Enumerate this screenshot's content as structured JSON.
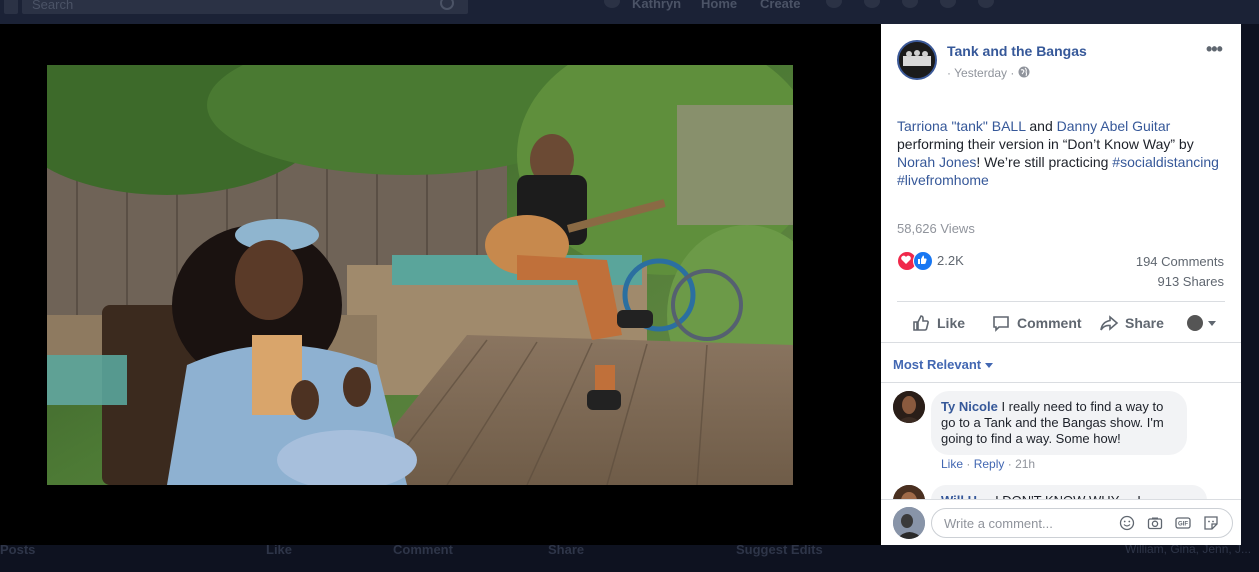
{
  "topbar": {
    "search_placeholder": "Search",
    "user_name": "Kathryn",
    "nav_home": "Home",
    "nav_create": "Create"
  },
  "bottombar": {
    "posts_label": "Posts",
    "like_label": "Like",
    "comment_label": "Comment",
    "share_label": "Share",
    "suggest_edits_label": "Suggest Edits",
    "right_text": "William, Gina, Jenn, J..."
  },
  "post": {
    "page_name": "Tank and the Bangas",
    "time": "· Yesterday ·",
    "text": {
      "mention1": "Tarriona \"tank\" BALL",
      "and": " and ",
      "mention2": "Danny Abel Guitar",
      "middle": " performing their version in “Don’t Know Way” by ",
      "mention3": "Norah Jones",
      "after": "! We’re still practicing ",
      "hashtag1": "#socialdistancing",
      "hashtag2": "#livefromhome"
    },
    "views": "58,626 Views",
    "reactions_count": "2.2K",
    "comments_count": "194 Comments",
    "shares_count": "913 Shares",
    "actions": {
      "like": "Like",
      "comment": "Comment",
      "share": "Share"
    }
  },
  "comments": {
    "sort_label": "Most Relevant",
    "items": [
      {
        "author": "Ty Nicole",
        "text": " I really need to find a way to go to a Tank and the Bangas show. I'm going to find a way. Some how!",
        "like": "Like",
        "reply": "Reply",
        "time": "21h"
      },
      {
        "author": "Will H",
        "text": "... I DON'T KNOW WHY ... I"
      }
    ],
    "composer_placeholder": "Write a comment..."
  },
  "colors": {
    "link": "#365899",
    "accent": "#4267b2",
    "love": "#f0284a",
    "like": "#1877f2"
  }
}
